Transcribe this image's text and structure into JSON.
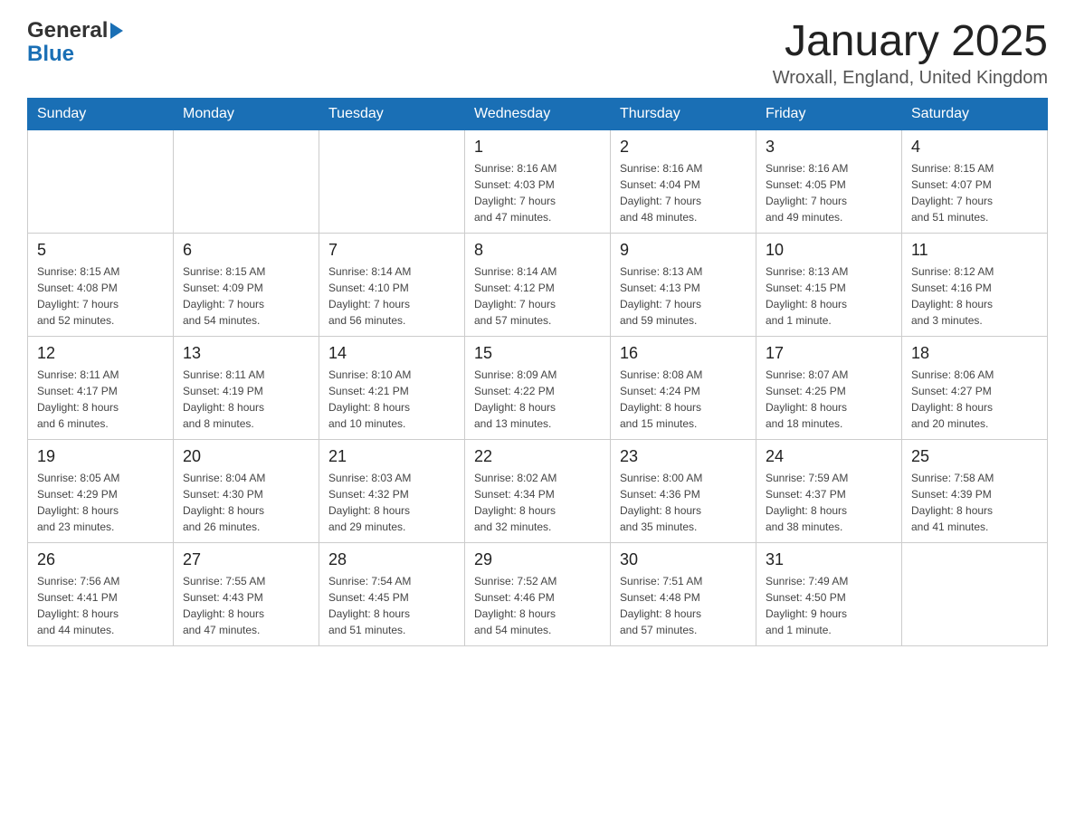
{
  "header": {
    "logo_general": "General",
    "logo_blue": "Blue",
    "title": "January 2025",
    "subtitle": "Wroxall, England, United Kingdom"
  },
  "weekdays": [
    "Sunday",
    "Monday",
    "Tuesday",
    "Wednesday",
    "Thursday",
    "Friday",
    "Saturday"
  ],
  "weeks": [
    [
      {
        "day": "",
        "info": ""
      },
      {
        "day": "",
        "info": ""
      },
      {
        "day": "",
        "info": ""
      },
      {
        "day": "1",
        "info": "Sunrise: 8:16 AM\nSunset: 4:03 PM\nDaylight: 7 hours\nand 47 minutes."
      },
      {
        "day": "2",
        "info": "Sunrise: 8:16 AM\nSunset: 4:04 PM\nDaylight: 7 hours\nand 48 minutes."
      },
      {
        "day": "3",
        "info": "Sunrise: 8:16 AM\nSunset: 4:05 PM\nDaylight: 7 hours\nand 49 minutes."
      },
      {
        "day": "4",
        "info": "Sunrise: 8:15 AM\nSunset: 4:07 PM\nDaylight: 7 hours\nand 51 minutes."
      }
    ],
    [
      {
        "day": "5",
        "info": "Sunrise: 8:15 AM\nSunset: 4:08 PM\nDaylight: 7 hours\nand 52 minutes."
      },
      {
        "day": "6",
        "info": "Sunrise: 8:15 AM\nSunset: 4:09 PM\nDaylight: 7 hours\nand 54 minutes."
      },
      {
        "day": "7",
        "info": "Sunrise: 8:14 AM\nSunset: 4:10 PM\nDaylight: 7 hours\nand 56 minutes."
      },
      {
        "day": "8",
        "info": "Sunrise: 8:14 AM\nSunset: 4:12 PM\nDaylight: 7 hours\nand 57 minutes."
      },
      {
        "day": "9",
        "info": "Sunrise: 8:13 AM\nSunset: 4:13 PM\nDaylight: 7 hours\nand 59 minutes."
      },
      {
        "day": "10",
        "info": "Sunrise: 8:13 AM\nSunset: 4:15 PM\nDaylight: 8 hours\nand 1 minute."
      },
      {
        "day": "11",
        "info": "Sunrise: 8:12 AM\nSunset: 4:16 PM\nDaylight: 8 hours\nand 3 minutes."
      }
    ],
    [
      {
        "day": "12",
        "info": "Sunrise: 8:11 AM\nSunset: 4:17 PM\nDaylight: 8 hours\nand 6 minutes."
      },
      {
        "day": "13",
        "info": "Sunrise: 8:11 AM\nSunset: 4:19 PM\nDaylight: 8 hours\nand 8 minutes."
      },
      {
        "day": "14",
        "info": "Sunrise: 8:10 AM\nSunset: 4:21 PM\nDaylight: 8 hours\nand 10 minutes."
      },
      {
        "day": "15",
        "info": "Sunrise: 8:09 AM\nSunset: 4:22 PM\nDaylight: 8 hours\nand 13 minutes."
      },
      {
        "day": "16",
        "info": "Sunrise: 8:08 AM\nSunset: 4:24 PM\nDaylight: 8 hours\nand 15 minutes."
      },
      {
        "day": "17",
        "info": "Sunrise: 8:07 AM\nSunset: 4:25 PM\nDaylight: 8 hours\nand 18 minutes."
      },
      {
        "day": "18",
        "info": "Sunrise: 8:06 AM\nSunset: 4:27 PM\nDaylight: 8 hours\nand 20 minutes."
      }
    ],
    [
      {
        "day": "19",
        "info": "Sunrise: 8:05 AM\nSunset: 4:29 PM\nDaylight: 8 hours\nand 23 minutes."
      },
      {
        "day": "20",
        "info": "Sunrise: 8:04 AM\nSunset: 4:30 PM\nDaylight: 8 hours\nand 26 minutes."
      },
      {
        "day": "21",
        "info": "Sunrise: 8:03 AM\nSunset: 4:32 PM\nDaylight: 8 hours\nand 29 minutes."
      },
      {
        "day": "22",
        "info": "Sunrise: 8:02 AM\nSunset: 4:34 PM\nDaylight: 8 hours\nand 32 minutes."
      },
      {
        "day": "23",
        "info": "Sunrise: 8:00 AM\nSunset: 4:36 PM\nDaylight: 8 hours\nand 35 minutes."
      },
      {
        "day": "24",
        "info": "Sunrise: 7:59 AM\nSunset: 4:37 PM\nDaylight: 8 hours\nand 38 minutes."
      },
      {
        "day": "25",
        "info": "Sunrise: 7:58 AM\nSunset: 4:39 PM\nDaylight: 8 hours\nand 41 minutes."
      }
    ],
    [
      {
        "day": "26",
        "info": "Sunrise: 7:56 AM\nSunset: 4:41 PM\nDaylight: 8 hours\nand 44 minutes."
      },
      {
        "day": "27",
        "info": "Sunrise: 7:55 AM\nSunset: 4:43 PM\nDaylight: 8 hours\nand 47 minutes."
      },
      {
        "day": "28",
        "info": "Sunrise: 7:54 AM\nSunset: 4:45 PM\nDaylight: 8 hours\nand 51 minutes."
      },
      {
        "day": "29",
        "info": "Sunrise: 7:52 AM\nSunset: 4:46 PM\nDaylight: 8 hours\nand 54 minutes."
      },
      {
        "day": "30",
        "info": "Sunrise: 7:51 AM\nSunset: 4:48 PM\nDaylight: 8 hours\nand 57 minutes."
      },
      {
        "day": "31",
        "info": "Sunrise: 7:49 AM\nSunset: 4:50 PM\nDaylight: 9 hours\nand 1 minute."
      },
      {
        "day": "",
        "info": ""
      }
    ]
  ]
}
